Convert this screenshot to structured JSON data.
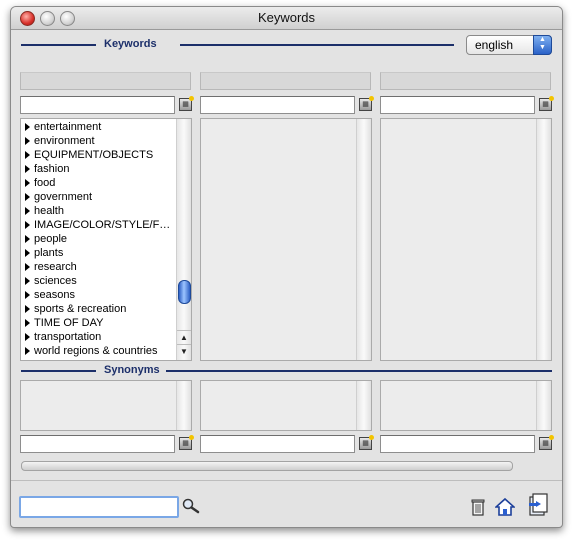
{
  "window": {
    "title": "Keywords"
  },
  "sections": {
    "keywords": "Keywords",
    "synonyms": "Synonyms"
  },
  "language_select": {
    "selected": "english"
  },
  "keywords_list": [
    {
      "label": "entertainment"
    },
    {
      "label": "environment"
    },
    {
      "label": "EQUIPMENT/OBJECTS"
    },
    {
      "label": "fashion"
    },
    {
      "label": "food"
    },
    {
      "label": "government"
    },
    {
      "label": "health"
    },
    {
      "label": "IMAGE/COLOR/STYLE/F…"
    },
    {
      "label": "people"
    },
    {
      "label": "plants"
    },
    {
      "label": "research"
    },
    {
      "label": "sciences"
    },
    {
      "label": "seasons"
    },
    {
      "label": "sports & recreation"
    },
    {
      "label": "TIME OF DAY"
    },
    {
      "label": "transportation"
    },
    {
      "label": "world regions & countries"
    }
  ],
  "keywords_scroll_position": 0.85,
  "icons": {
    "filter": "filter-icon",
    "search": "magnifier-icon",
    "trash": "trash-icon",
    "home": "home-icon",
    "export": "export-icon"
  },
  "colors": {
    "accent": "#1c2f6a",
    "scroll_thumb": "#2d5fc4"
  }
}
